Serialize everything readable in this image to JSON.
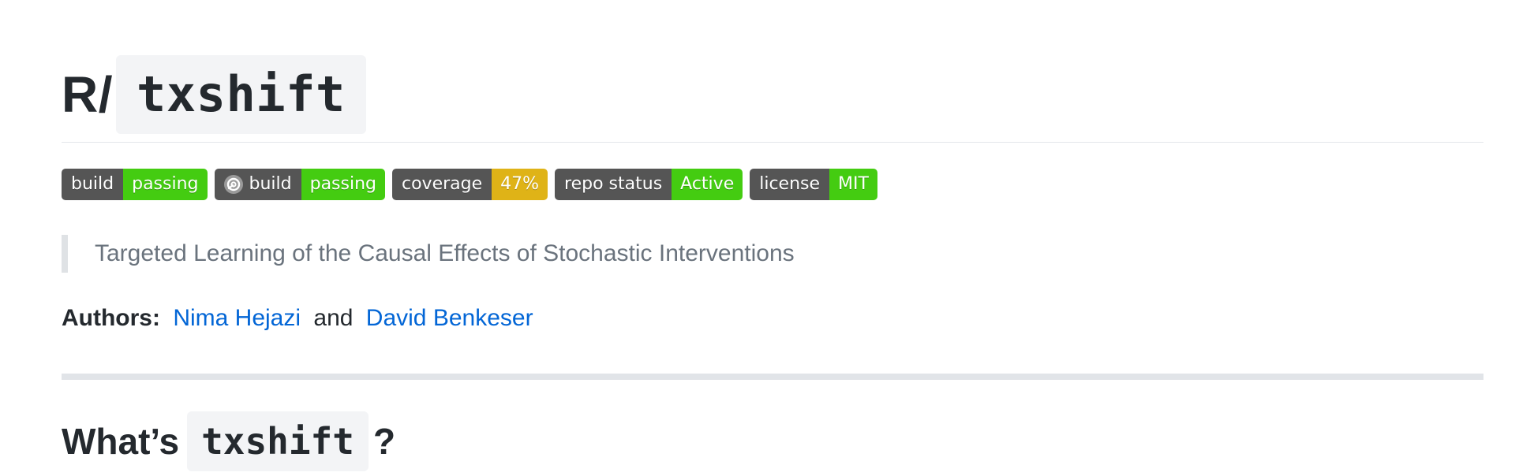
{
  "header": {
    "title_prefix": "R/",
    "title_code": "txshift"
  },
  "badges": [
    {
      "left": "build",
      "right": "passing",
      "right_color": "#4c1",
      "icon": ""
    },
    {
      "left": "build",
      "right": "passing",
      "right_color": "#4c1",
      "icon": "appveyor-icon"
    },
    {
      "left": "coverage",
      "right": "47%",
      "right_color": "#dfb317",
      "icon": ""
    },
    {
      "left": "repo status",
      "right": "Active",
      "right_color": "#4c1",
      "icon": ""
    },
    {
      "left": "license",
      "right": "MIT",
      "right_color": "#4c1",
      "icon": ""
    }
  ],
  "description": "Targeted Learning of the Causal Effects of Stochastic Interventions",
  "authors": {
    "label": "Authors:",
    "author1": "Nima Hejazi",
    "conjunction": "and",
    "author2": "David Benkeser"
  },
  "section": {
    "prefix": "What’s",
    "code": "txshift",
    "suffix": "?"
  },
  "colors": {
    "link": "#0366d6",
    "badge_left": "#555555",
    "badge_green": "#4c1",
    "badge_yellow": "#dfb317"
  }
}
